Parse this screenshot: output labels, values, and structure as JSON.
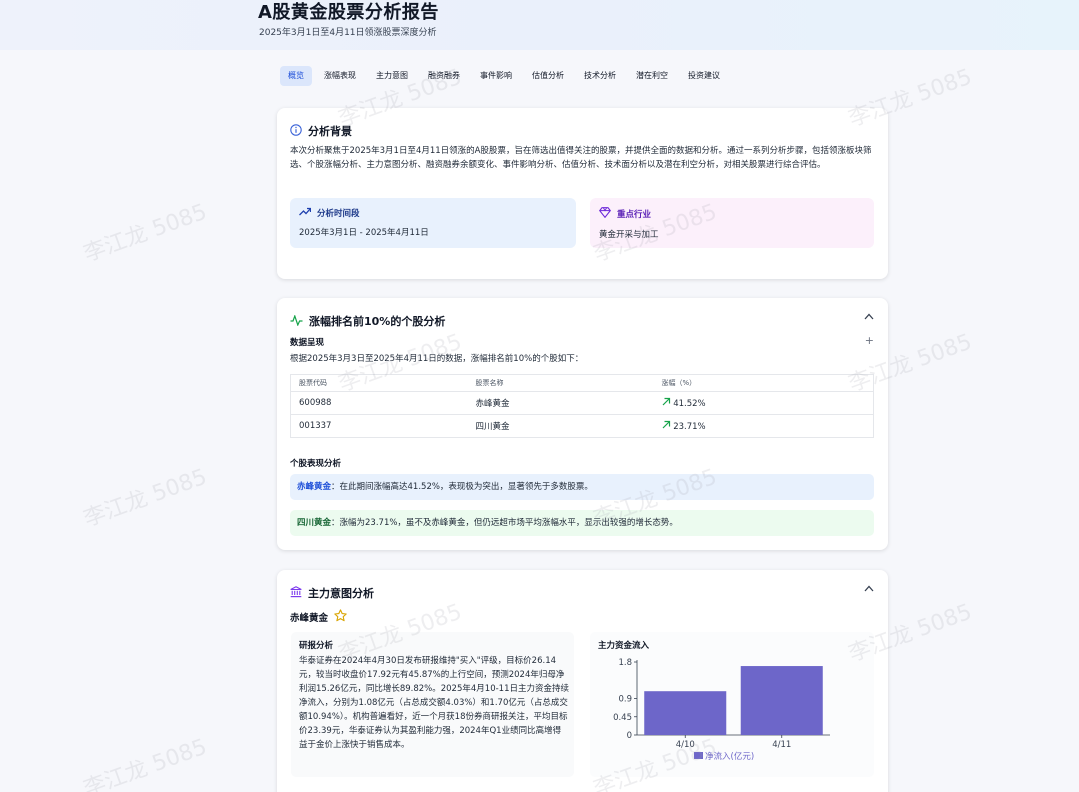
{
  "header": {
    "title": "A股黄金股票分析报告",
    "subtitle": "2025年3月1日至4月11日领涨股票深度分析"
  },
  "tabs": [
    "概览",
    "涨幅表现",
    "主力意图",
    "融资融券",
    "事件影响",
    "估值分析",
    "技术分析",
    "潜在利空",
    "投资建议"
  ],
  "background": {
    "title": "分析背景",
    "text": "本次分析聚焦于2025年3月1日至4月11日领涨的A股股票，旨在筛选出值得关注的股票，并提供全面的数据和分析。通过一系列分析步骤，包括领涨板块筛选、个股涨幅分析、主力意图分析、融资融券余额变化、事件影响分析、估值分析、技术面分析以及潜在利空分析，对相关股票进行综合评估。",
    "period_label": "分析时间段",
    "period_value": "2025年3月1日 - 2025年4月11日",
    "industry_label": "重点行业",
    "industry_value": "黄金开采与加工"
  },
  "top_gainers": {
    "title": "涨幅排名前10%的个股分析",
    "data_heading": "数据呈现",
    "intro": "根据2025年3月3日至2025年4月11日的数据，涨幅排名前10%的个股如下：",
    "columns": [
      "股票代码",
      "股票名称",
      "涨幅（%）"
    ],
    "rows": [
      {
        "code": "600988",
        "name": "赤峰黄金",
        "change": "41.52%"
      },
      {
        "code": "001337",
        "name": "四川黄金",
        "change": "23.71%"
      }
    ],
    "perf_heading": "个股表现分析",
    "notes": [
      {
        "name": "赤峰黄金",
        "text": "：在此期间涨幅高达41.52%，表现极为突出，显著领先于多数股票。"
      },
      {
        "name": "四川黄金",
        "text": "：涨幅为23.71%，虽不及赤峰黄金，但仍远超市场平均涨幅水平，显示出较强的增长态势。"
      }
    ]
  },
  "main_intent": {
    "title": "主力意图分析",
    "stock": "赤峰黄金",
    "research_heading": "研报分析",
    "research_text": "华泰证券在2024年4月30日发布研报维持\"买入\"评级，目标价26.14元，较当时收盘价17.92元有45.87%的上行空间，预测2024年归母净利润15.26亿元，同比增长89.82%。2025年4月10-11日主力资金持续净流入，分别为1.08亿元（占总成交额4.03%）和1.70亿元（占总成交额10.94%）。机构普遍看好，近一个月获18份券商研报关注，平均目标价23.39元，华泰证券认为其盈利能力强，2024年Q1业绩同比高增得益于金价上涨快于销售成本。",
    "flow_heading": "主力资金流入"
  },
  "chart_data": {
    "type": "bar",
    "title": "主力资金流入",
    "categories": [
      "4/10",
      "4/11"
    ],
    "series": [
      {
        "name": "净流入(亿元)",
        "values": [
          1.08,
          1.7
        ]
      }
    ],
    "yticks": [
      "1.8",
      "0.9",
      "0.45",
      "0"
    ],
    "ylim": [
      0,
      1.8
    ],
    "legend": "bottom",
    "color": "#6d66c9"
  },
  "watermark": "李江龙 5085"
}
